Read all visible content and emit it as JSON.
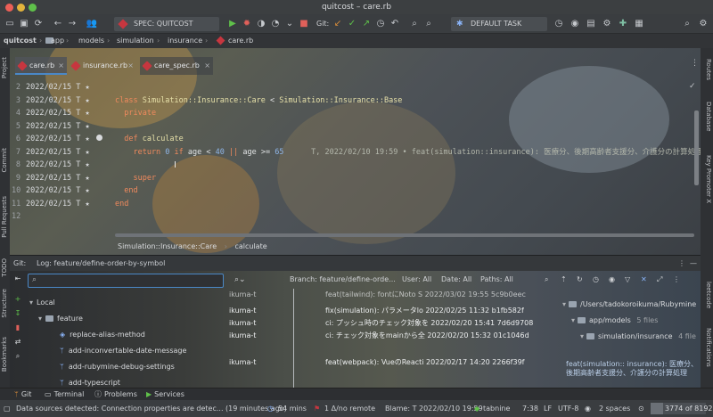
{
  "window": {
    "title": "quitcost – care.rb"
  },
  "toolbar": {
    "run_config": "SPEC: QUITCOST",
    "git_label": "Git:",
    "task_combo": "DEFAULT TASK"
  },
  "breadcrumb": [
    "quitcost",
    "app",
    "models",
    "simulation",
    "insurance",
    "care.rb"
  ],
  "left_tools": [
    "Project",
    "Commit",
    "Pull Requests",
    "TODO",
    "Structure",
    "Bookmarks"
  ],
  "right_tools": [
    "Routes",
    "Database",
    "Key Promoter X",
    "leetcode",
    "Notifications"
  ],
  "tabs": [
    {
      "label": "care.rb",
      "active": true
    },
    {
      "label": "insurance.rb",
      "active": false
    },
    {
      "label": "care_spec.rb",
      "active": false
    }
  ],
  "gutter": [
    {
      "num": "2",
      "blame": "2022/02/15 T ★"
    },
    {
      "num": "3",
      "blame": "2022/02/15 T ★"
    },
    {
      "num": "4",
      "blame": "2022/02/15 T ★"
    },
    {
      "num": "5",
      "blame": "2022/02/15 T ★"
    },
    {
      "num": "6",
      "blame": "2022/02/15 T ★"
    },
    {
      "num": "7",
      "blame": "2022/02/15 T ★"
    },
    {
      "num": "8",
      "blame": "2022/02/15 T ★"
    },
    {
      "num": "9",
      "blame": "2022/02/15 T ★"
    },
    {
      "num": "10",
      "blame": "2022/02/15 T ★"
    },
    {
      "num": "11",
      "blame": "2022/02/15 T ★"
    },
    {
      "num": "12",
      "blame": ""
    }
  ],
  "code": {
    "line1_kw": "class ",
    "line1_cls": "Simulation::Insurance::Care",
    "line1_op": " < ",
    "line1_base": "Simulation::Insurance::Base",
    "line2": "  private",
    "line4_kw": "  def ",
    "line4_name": "calculate",
    "line5_ret": "    return ",
    "line5_zero": "0",
    "line5_if": " if ",
    "line5_cond1": "age < ",
    "line5_40": "40",
    "line5_or": " || ",
    "line5_cond2": "age >= ",
    "line5_65": "65",
    "line5_hint": "      T, 2022/02/10 19:59 • feat(simulation::insurance): 医療分、後期高齢者支援分、介護分の計算処理",
    "line8": "    super",
    "line9": "  end",
    "line10": "end"
  },
  "editor_crumb": {
    "cls": "Simulation::Insurance::Care",
    "method": "calculate"
  },
  "git": {
    "tab_git": "Git:",
    "tab_log": "Log: feature/define-order-by-symbol",
    "search_placeholder": "",
    "filters": {
      "branch": "Branch: feature/define-orde...",
      "user": "User: All",
      "date": "Date: All",
      "paths": "Paths: All"
    },
    "local_label": "Local",
    "feature_label": "feature",
    "branches": [
      "replace-alias-method",
      "add-inconvertable-date-message",
      "add-rubymine-debug-settings",
      "add-typescript"
    ],
    "commits": [
      {
        "author": "ikuma-t",
        "msg": "feat(tailwind): fontにNoto S 2022/03/02 19:55 5c9b0eec"
      },
      {
        "author": "ikuma-t",
        "msg": "fix(simulation): パラメータlo 2022/02/25 11:32 b1fb582f"
      },
      {
        "author": "ikuma-t",
        "msg": "ci: プッシュ時のチェック対象を 2022/02/20 15:41 7d6d9708"
      },
      {
        "author": "ikuma-t",
        "msg": "ci: チェック対象をmainから全 2022/02/20 15:32 01c1046d"
      },
      {
        "author": "ikuma-t",
        "msg": "feat(webpack): VueのReacti 2022/02/17 14:20 2266f39f"
      }
    ],
    "tree": {
      "root": "/Users/tadokoroikuma/Rubymine",
      "models": "app/models",
      "models_count": "5 files",
      "insurance": "simulation/insurance",
      "insurance_count": "4 file"
    },
    "detail": "feat(simulation:: insurance): 医療分、後期高齢者支援分、介護分の計算処理"
  },
  "bottom_tabs": [
    "Git",
    "Terminal",
    "Problems",
    "Services"
  ],
  "status": {
    "message": "Data sources detected: Connection properties are detec... (19 minutes ago)",
    "time_tracker": "54 mins",
    "git_sync": "1 Δ/no remote",
    "blame": "Blame: T 2022/02/10 19:59",
    "plugin": "tabnine",
    "position": "7:38",
    "line_sep": "LF",
    "encoding": "UTF-8",
    "indent": "2 spaces",
    "memory": "3774 of 8192M"
  }
}
